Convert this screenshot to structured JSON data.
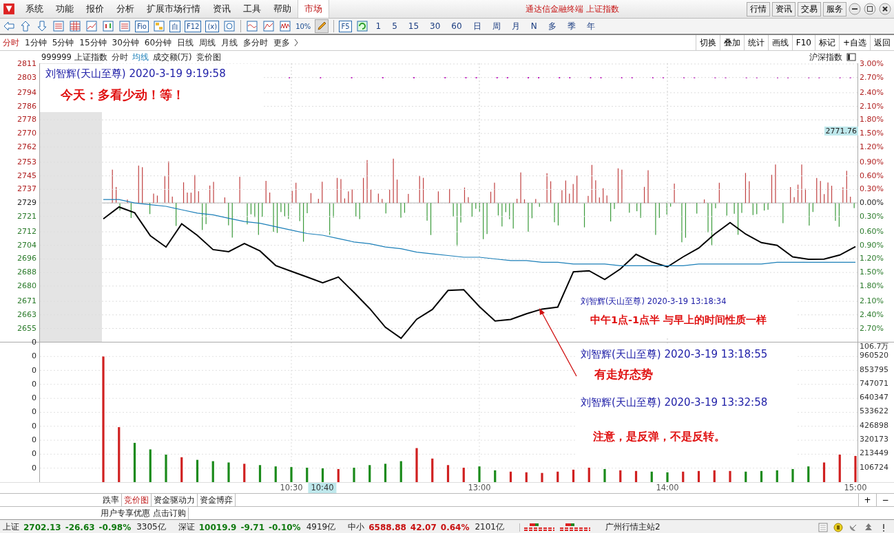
{
  "title_bar": {
    "menu": [
      {
        "label": "系统",
        "selected": false
      },
      {
        "label": "功能",
        "selected": false
      },
      {
        "label": "报价",
        "selected": false
      },
      {
        "label": "分析",
        "selected": false
      },
      {
        "label": "扩展市场行情",
        "selected": false
      },
      {
        "label": "资讯",
        "selected": false
      },
      {
        "label": "工具",
        "selected": false
      },
      {
        "label": "帮助",
        "selected": false
      },
      {
        "label": "市场",
        "selected": true
      }
    ],
    "title": "通达信金融终端 上证指数",
    "buttons": [
      "行情",
      "资讯",
      "交易",
      "服务"
    ]
  },
  "toolbar": {
    "items": [
      {
        "kind": "arrow-left"
      },
      {
        "kind": "arrow-up"
      },
      {
        "kind": "arrow-down"
      },
      {
        "kind": "list"
      },
      {
        "kind": "grid"
      },
      {
        "kind": "line"
      },
      {
        "kind": "candle"
      },
      {
        "kind": "list"
      },
      {
        "kind": "boxed",
        "label": "Fio"
      },
      {
        "kind": "tree"
      },
      {
        "kind": "boxed",
        "label": "自"
      },
      {
        "kind": "boxed",
        "label": "F12"
      },
      {
        "kind": "boxed",
        "label": "(x)"
      },
      {
        "kind": "circle"
      },
      {
        "kind": "sep"
      },
      {
        "kind": "wave"
      },
      {
        "kind": "mountain"
      },
      {
        "kind": "zigzag"
      },
      {
        "kind": "text",
        "label": "10%"
      },
      {
        "kind": "pencil"
      },
      {
        "kind": "sep"
      },
      {
        "kind": "boxed",
        "label": "F5"
      },
      {
        "kind": "refresh"
      }
    ],
    "periods": [
      "1",
      "5",
      "15",
      "30",
      "60",
      "日",
      "周",
      "月",
      "N",
      "多",
      "季",
      "年"
    ]
  },
  "period_tabs": [
    {
      "label": "分时",
      "selected": true
    },
    {
      "label": "1分钟",
      "selected": false
    },
    {
      "label": "5分钟",
      "selected": false
    },
    {
      "label": "15分钟",
      "selected": false
    },
    {
      "label": "30分钟",
      "selected": false
    },
    {
      "label": "60分钟",
      "selected": false
    },
    {
      "label": "日线",
      "selected": false
    },
    {
      "label": "周线",
      "selected": false
    },
    {
      "label": "月线",
      "selected": false
    },
    {
      "label": "多分时",
      "selected": false
    },
    {
      "label": "更多",
      "selected": false
    }
  ],
  "right_buttons": [
    "切换",
    "叠加",
    "统计",
    "画线",
    "F10",
    "标记",
    "+自选",
    "返回"
  ],
  "info": {
    "security": "999999 上证指数",
    "items": [
      "成交额(万)",
      "竞价图"
    ],
    "index_switch": "沪深指数"
  },
  "price_chart": {
    "chart_data": {
      "type": "line",
      "grid": true,
      "ylim": [
        2647.1,
        2811.4
      ],
      "series": [
        {
          "name": "分时",
          "color": "#000000",
          "values": [
            2719.6,
            2726.6,
            2723.2,
            2709.6,
            2703.0,
            2716.7,
            2709.9,
            2701.5,
            2700.3,
            2705.1,
            2700.7,
            2692.1,
            2688.7,
            2685.3,
            2681.9,
            2685.3,
            2676.2,
            2666.7,
            2655.7,
            2649.2,
            2660.4,
            2666.2,
            2677.4,
            2677.8,
            2667.9,
            2659.4,
            2660.3,
            2663.6,
            2666.4,
            2667.6,
            2688.4,
            2689.0,
            2683.9,
            2690.1,
            2698.7,
            2694.2,
            2691.3,
            2697.2,
            2702.4,
            2710.6,
            2717.4,
            2710.6,
            2705.6,
            2704.0,
            2697.2,
            2695.8,
            2695.9,
            2698.3,
            2703.2
          ]
        },
        {
          "name": "均线",
          "color": "#1b7fb8",
          "values": [
            2731,
            2731,
            2729,
            2728,
            2727,
            2725,
            2723,
            2722,
            2720,
            2718,
            2717,
            2715,
            2713,
            2711,
            2710,
            2708,
            2706,
            2705,
            2703,
            2702,
            2700,
            2699,
            2698,
            2697,
            2697,
            2696,
            2695,
            2695,
            2694,
            2694,
            2693,
            2693,
            2693,
            2692,
            2692,
            2692,
            2692,
            2692,
            2693,
            2693,
            2693,
            2693,
            2693,
            2694,
            2694,
            2694,
            2694,
            2694,
            2694
          ]
        }
      ],
      "yticks": [
        2811,
        2803,
        2794,
        2786,
        2778,
        2770,
        2762,
        2753,
        2745,
        2737,
        2729,
        2721,
        2712,
        2704,
        2696,
        2688,
        2680,
        2671,
        2663,
        2655
      ]
    },
    "pct_labels": [
      {
        "label": "3.00%",
        "kind": "up"
      },
      {
        "label": "2.70%",
        "kind": "up"
      },
      {
        "label": "2.40%",
        "kind": "up"
      },
      {
        "label": "2.10%",
        "kind": "up"
      },
      {
        "label": "1.80%",
        "kind": "up"
      },
      {
        "label": "1.50%",
        "kind": "up"
      },
      {
        "label": "1.20%",
        "kind": "up"
      },
      {
        "label": "0.90%",
        "kind": "up"
      },
      {
        "label": "0.60%",
        "kind": "up"
      },
      {
        "label": "0.30%",
        "kind": "up"
      },
      {
        "label": "0.00%",
        "kind": "flat"
      },
      {
        "label": "0.30%",
        "kind": "down"
      },
      {
        "label": "0.60%",
        "kind": "down"
      },
      {
        "label": "0.90%",
        "kind": "down"
      },
      {
        "label": "1.20%",
        "kind": "down"
      },
      {
        "label": "1.50%",
        "kind": "down"
      },
      {
        "label": "1.80%",
        "kind": "down"
      },
      {
        "label": "2.10%",
        "kind": "down"
      },
      {
        "label": "2.40%",
        "kind": "down"
      },
      {
        "label": "2.70%",
        "kind": "down"
      }
    ],
    "cursor": {
      "time": "10:40",
      "price": "2771.76"
    }
  },
  "volume_chart": {
    "chart_data": {
      "type": "bar",
      "grid": true,
      "ylim": [
        0,
        1067000
      ],
      "categories": [
        null,
        null,
        null,
        null,
        null,
        null,
        null,
        null,
        null,
        null,
        null,
        null,
        "10:30",
        null,
        null,
        null,
        null,
        null,
        null,
        null,
        null,
        null,
        null,
        null,
        "13:00",
        null,
        null,
        null,
        null,
        null,
        null,
        null,
        null,
        null,
        null,
        null,
        "14:00",
        null,
        null,
        null,
        null,
        null,
        null,
        null,
        null,
        null,
        null,
        null,
        "15:00"
      ],
      "series": [
        {
          "values": [
            960000,
            420000,
            300000,
            250000,
            210000,
            190000,
            170000,
            160000,
            150000,
            140000,
            130000,
            120000,
            115000,
            110000,
            105000,
            100000,
            110000,
            130000,
            140000,
            160000,
            260000,
            180000,
            130000,
            110000,
            120000,
            90000,
            80000,
            75000,
            70000,
            80000,
            95000,
            110000,
            100000,
            90000,
            85000,
            80000,
            75000,
            80000,
            85000,
            90000,
            85000,
            80000,
            85000,
            90000,
            100000,
            120000,
            150000,
            210000,
            200000
          ]
        }
      ],
      "yticks": [
        960520,
        853795,
        747071,
        640347,
        533622,
        426898,
        320173,
        213449,
        106724
      ]
    },
    "top_label": "106.7万",
    "left_labels": [
      "0",
      "0",
      "0",
      "0",
      "0",
      "0",
      "0",
      "0",
      "0",
      "0"
    ]
  },
  "annotations": [
    {
      "author": "刘智辉(天山至尊) 2020-3-19 9:19:58",
      "note": "今天：多看少动！等！"
    },
    {
      "author": "刘智辉(天山至尊) 2020-3-19 13:18:34",
      "note": "中午1点-1点半 与早上的时间性质一样"
    },
    {
      "author": "刘智辉(天山至尊) 2020-3-19 13:18:55",
      "note": "有走好态势"
    },
    {
      "author": "刘智辉(天山至尊) 2020-3-19 13:32:58",
      "note": "注意，是反弹，不是反转。"
    }
  ],
  "bottom_tabs": [
    {
      "label": "跌率",
      "selected": false
    },
    {
      "label": "竞价图",
      "selected": true
    },
    {
      "label": "资金驱动力",
      "selected": false
    },
    {
      "label": "资金博弈",
      "selected": false
    }
  ],
  "zoom_buttons": [
    "+",
    "−"
  ],
  "ad": {
    "text": "用户专享优惠",
    "link": "点击订购"
  },
  "status_bar": {
    "indices": [
      {
        "name": "上证",
        "price": "2702.13",
        "change": "-26.63",
        "pct": "-0.98%",
        "amount": "3305亿",
        "up": false
      },
      {
        "name": "深证",
        "price": "10019.9",
        "change": "-9.71",
        "pct": "-0.10%",
        "amount": "4919亿",
        "up": false
      },
      {
        "name": "中小",
        "price": "6588.88",
        "change": "42.07",
        "pct": "0.64%",
        "amount": "2101亿",
        "up": true
      }
    ],
    "server": "广州行情主站2"
  }
}
